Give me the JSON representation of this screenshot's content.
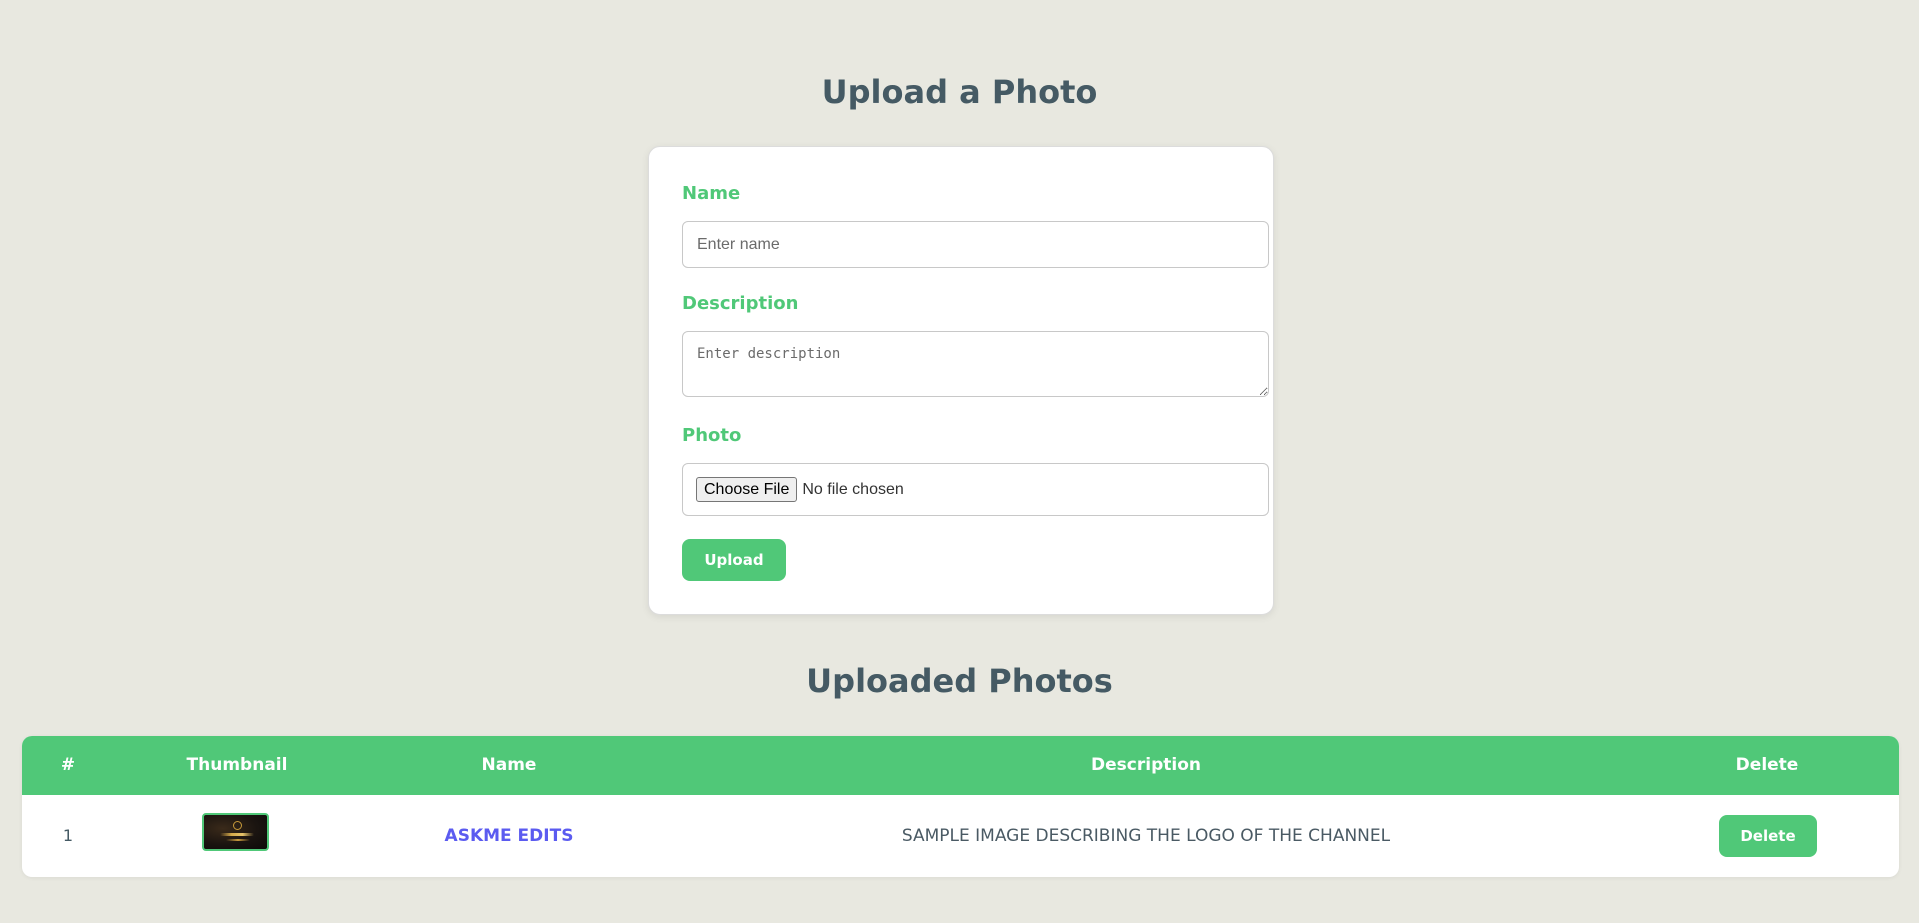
{
  "upload_section": {
    "title": "Upload a Photo",
    "name_label": "Name",
    "name_placeholder": "Enter name",
    "name_value": "",
    "description_label": "Description",
    "description_placeholder": "Enter description",
    "description_value": "",
    "photo_label": "Photo",
    "choose_file_label": "Choose File",
    "file_status": "No file chosen",
    "upload_label": "Upload"
  },
  "photos_section": {
    "title": "Uploaded Photos",
    "columns": [
      "#",
      "Thumbnail",
      "Name",
      "Description",
      "Delete"
    ],
    "rows": [
      {
        "index": "1",
        "thumbnail_icon": "channel-logo-thumbnail",
        "name": "ASKME EDITS",
        "description": "SAMPLE IMAGE DESCRIBING THE LOGO OF THE CHANNEL",
        "delete_label": "Delete"
      }
    ]
  },
  "colors": {
    "accent": "#50c878",
    "heading": "#455a64",
    "link": "#5b5bf0",
    "background": "#e8e8e0"
  }
}
